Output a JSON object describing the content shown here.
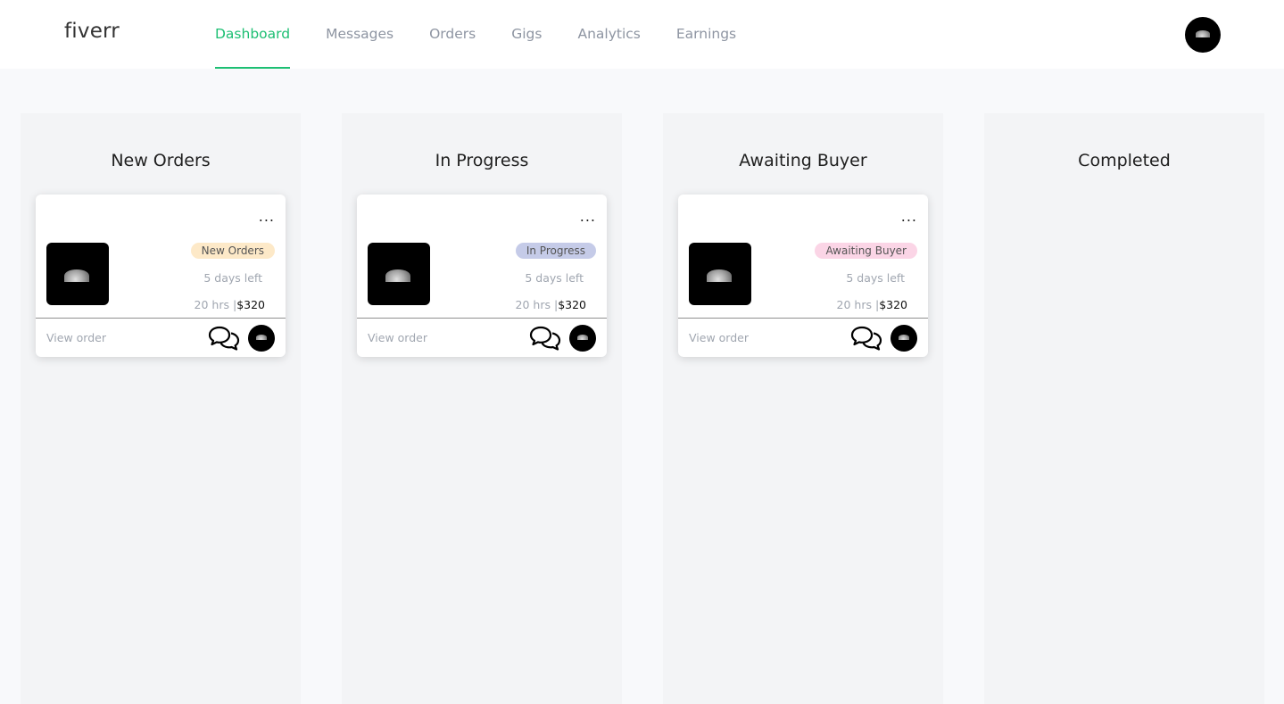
{
  "header": {
    "logo": "fiverr",
    "nav": [
      "Dashboard",
      "Messages",
      "Orders",
      "Gigs",
      "Analytics",
      "Earnings"
    ],
    "active_nav": "Dashboard",
    "avatar_icon": "moon-avatar-icon"
  },
  "colors": {
    "accent": "#1dbf73",
    "badge_new": "#fde9c8",
    "badge_in_progress": "#c5cbe8",
    "badge_awaiting": "#fbd5e6"
  },
  "columns": [
    {
      "title": "New Orders",
      "card": {
        "menu": "...",
        "status": "New Orders",
        "days_left": "5 days left",
        "hours": "20 hrs",
        "separator": "|",
        "price": "$320",
        "view_order": "View order"
      }
    },
    {
      "title": "In Progress",
      "card": {
        "menu": "...",
        "status": "In Progress",
        "days_left": "5 days left",
        "hours": "20 hrs",
        "separator": "|",
        "price": "$320",
        "view_order": "View order"
      }
    },
    {
      "title": "Awaiting Buyer",
      "card": {
        "menu": "...",
        "status": "Awaiting Buyer",
        "days_left": "5 days left",
        "hours": "20 hrs",
        "separator": "|",
        "price": "$320",
        "view_order": "View order"
      }
    },
    {
      "title": "Completed"
    }
  ]
}
